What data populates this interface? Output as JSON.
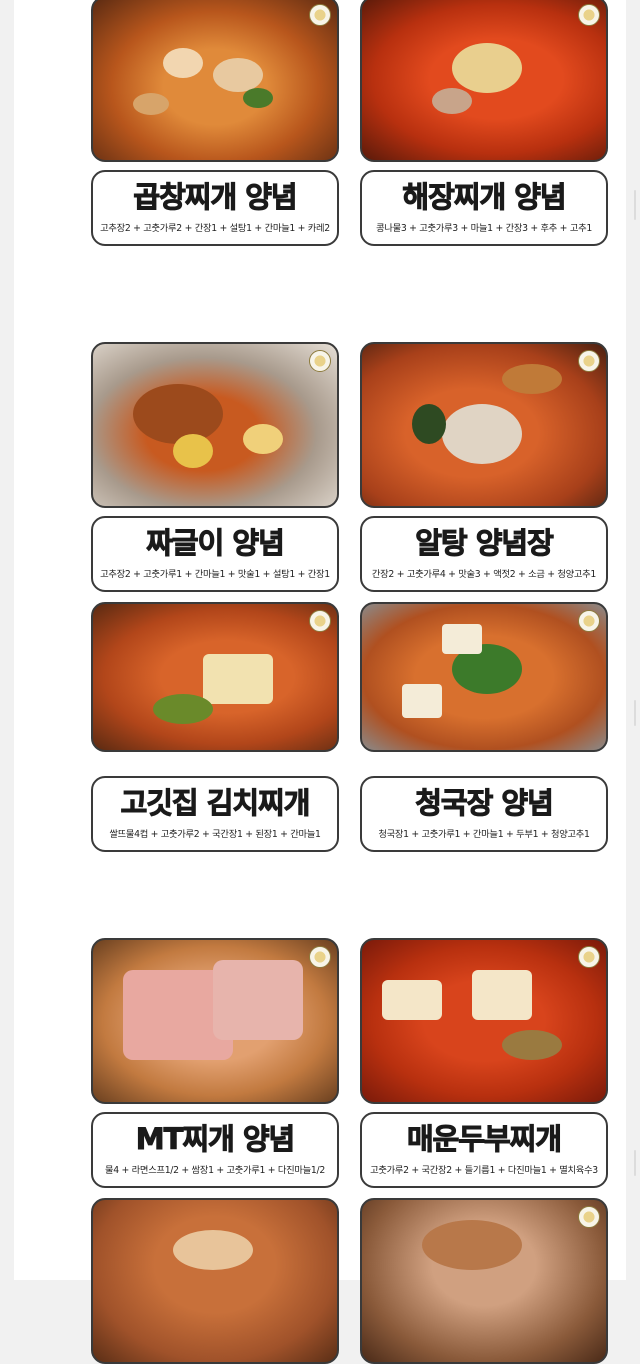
{
  "cards": [
    {
      "title": "곱창찌개 양념",
      "ingredients": "고추장2 + 고춧가루2 + 간장1 + 설탕1 + 간마늘1 + 카레2",
      "photo": "gopchang-stew-photo"
    },
    {
      "title": "해장찌개 양념",
      "ingredients": "콩나물3 + 고춧가루3 + 마늘1 + 간장3 + 후추 + 고추1",
      "photo": "haejang-stew-photo"
    },
    {
      "title": "짜글이 양념",
      "ingredients": "고추장2 + 고춧가루1 + 간마늘1 + 맛술1 + 설탕1 + 간장1",
      "photo": "jjageuri-photo"
    },
    {
      "title": "알탕 양념장",
      "ingredients": "간장2 + 고춧가루4 + 맛술3 + 액젓2 + 소금 + 청양고추1",
      "photo": "altang-photo"
    },
    {
      "title": "고깃집 김치찌개",
      "ingredients": "쌀뜨물4컵 + 고춧가루2 + 국간장1 + 된장1 + 간마늘1",
      "photo": "kimchi-stew-photo"
    },
    {
      "title": "청국장 양념",
      "ingredients": "청국장1 + 고춧가루1 + 간마늘1 + 두부1 + 청양고추1",
      "photo": "cheonggukjang-photo"
    },
    {
      "title": "MT찌개 양념",
      "ingredients": "물4 + 라면스프1/2 + 쌈장1 + 고춧가루1 + 다진마늘1/2",
      "photo": "mt-stew-photo"
    },
    {
      "title": "매운두부찌개",
      "ingredients": "고춧가루2 + 국간장2 + 들기름1 + 다진마늘1 + 멸치육수3",
      "photo": "spicy-tofu-stew-photo"
    }
  ]
}
